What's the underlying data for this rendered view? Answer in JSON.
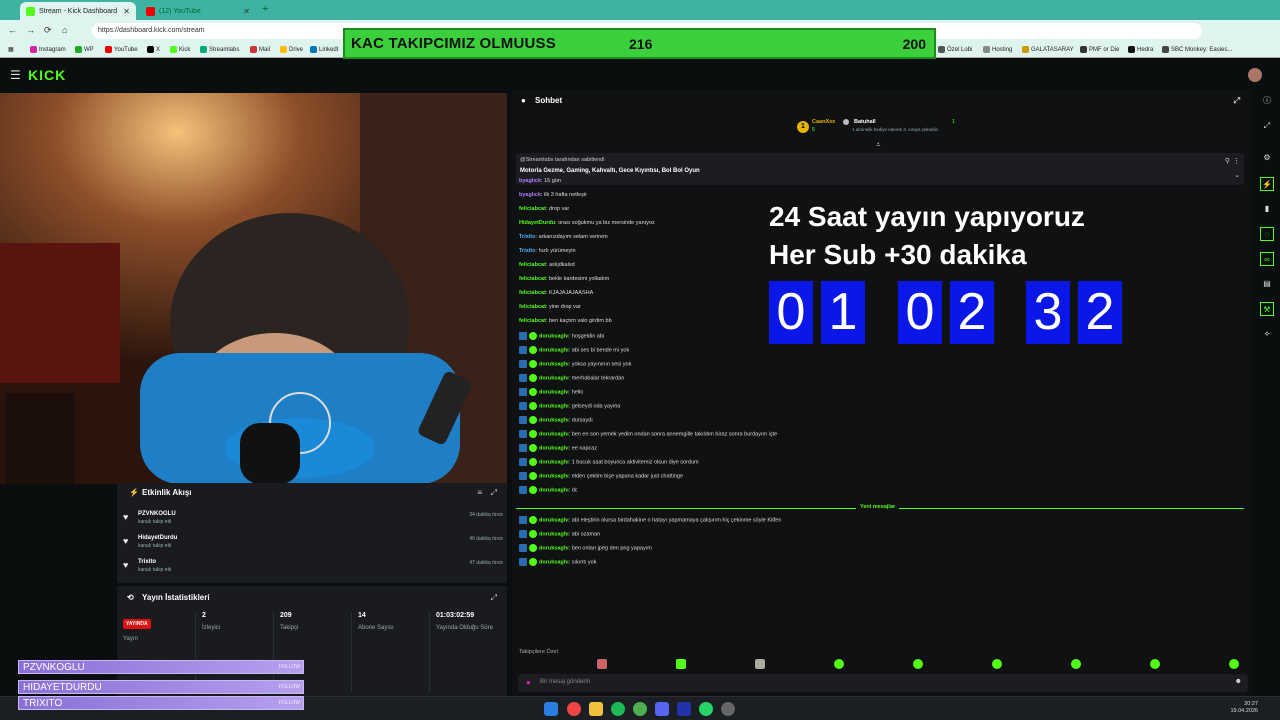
{
  "browser": {
    "tabs": [
      {
        "label": "Stream - Kick Dashboard"
      },
      {
        "label": "(12) YouTube"
      }
    ],
    "url": "https://dashboard.kick.com/stream",
    "bookmarks": [
      "Instagram",
      "WP",
      "YouTube",
      "X",
      "Kick",
      "Streamlabs",
      "Mail",
      "Drive",
      "LinkedI",
      "Özel Lobi",
      "Hosting",
      "GALATASARAY",
      "PMF or Die",
      "Hedra",
      "SBC Monkey: Easies..."
    ]
  },
  "goal": {
    "title": "KAC TAKIPCIMIZ OLMUUSS",
    "current": "216",
    "target": "200"
  },
  "header": {
    "logo": "KICK"
  },
  "activity": {
    "title": "Etkinlik Akışı",
    "items": [
      {
        "name": "PZVNKOGLU",
        "action": "kanalı takip etti",
        "time": "34 dakika önce"
      },
      {
        "name": "HidayetDurdu",
        "action": "kanalı takip etti",
        "time": "46 dakika önce"
      },
      {
        "name": "Trixito",
        "action": "kanalı takip etti",
        "time": "47 dakika önce"
      }
    ]
  },
  "stats": {
    "title": "Yayın İstatistikleri",
    "live_badge": "YAYINDA",
    "cols": [
      {
        "value": "",
        "label": "Yayın"
      },
      {
        "value": "2",
        "label": "İzleyici"
      },
      {
        "value": "209",
        "label": "Takipçi"
      },
      {
        "value": "14",
        "label": "Abone Sayısı"
      },
      {
        "value": "01:03:02:59",
        "label": "Yayında Olduğu Süre"
      }
    ]
  },
  "follow_alerts": [
    {
      "name": "PZVNKOGLU",
      "tag": "FOLLOW"
    },
    {
      "name": "HIDAYETDURDU",
      "tag": "FOLLOW"
    },
    {
      "name": "TRIXITO",
      "tag": "FOLLOW"
    }
  ],
  "chat": {
    "title": "Sohbet",
    "top_gifter": {
      "name": "CaanXxx",
      "count": "5"
    },
    "top_user": {
      "name": "Batuhall",
      "note": "1 abonelik hediye ederek 3. sıraya yükselin",
      "count": "1"
    },
    "pinned_by": "@Streamlabs tarafından sabitlendi",
    "pinned_text": "Motorla Gezme, Gaming, Kahvaltı, Gece Kıyıntısı, Bol Bol Oyun",
    "messages": [
      {
        "user": "byaglıck",
        "text": "15 gün",
        "color": "#b07cff"
      },
      {
        "user": "byaglıck",
        "text": "ilk 3 hafta netleşir",
        "color": "#b07cff"
      },
      {
        "user": "feliciabcat",
        "text": "drop var",
        "color": "#53fc18"
      },
      {
        "user": "HidayetDurdu",
        "text": "orası soğukmu ya biz mersinde yanıyoz",
        "color": "#53fc18"
      },
      {
        "user": "Trixito",
        "text": "arkanızdayım selam verirem",
        "color": "#4fb4ff"
      },
      {
        "user": "Trixito",
        "text": "hızlı yürümeyin",
        "color": "#4fb4ff"
      },
      {
        "user": "feliciabcat",
        "text": "aslıjdkalsd",
        "color": "#53fc18"
      },
      {
        "user": "feliciabcat",
        "text": "bekle kardesimi yolladım",
        "color": "#53fc18"
      },
      {
        "user": "feliciabcat",
        "text": "KJAJAJAJAASHA",
        "color": "#53fc18"
      },
      {
        "user": "feliciabcat",
        "text": "yine drop var",
        "color": "#53fc18"
      },
      {
        "user": "feliciabcat",
        "text": "ben kaçtım valo girdim bb",
        "color": "#53fc18"
      },
      {
        "user": "doruksaghı",
        "text": "hoşgeldin abi",
        "color": "#53fc18"
      },
      {
        "user": "doruksaghı",
        "text": "abi ses bi bende mi yok",
        "color": "#53fc18"
      },
      {
        "user": "doruksaghı",
        "text": "yoksa yayınının sesi yok",
        "color": "#53fc18"
      },
      {
        "user": "doruksaghı",
        "text": "merhabalar tekrardan",
        "color": "#53fc18"
      },
      {
        "user": "doruksaghı",
        "text": "hello",
        "color": "#53fc18"
      },
      {
        "user": "doruksaghı",
        "text": "gelseydi oda yayına",
        "color": "#53fc18"
      },
      {
        "user": "doruksaghı",
        "text": "dursaydı",
        "color": "#53fc18"
      },
      {
        "user": "doruksaghı",
        "text": "ben en son yemek yedim ondan sonra annemgille takıldım biraz sonra burdayım işte",
        "color": "#53fc18"
      },
      {
        "user": "doruksaghı",
        "text": "ee napcaz",
        "color": "#53fc18"
      },
      {
        "user": "doruksaghı",
        "text": "1 bucuk saat boyunca aktivitemiz olsun diye sordum",
        "color": "#53fc18"
      },
      {
        "user": "doruksaghı",
        "text": "elden çektim bişe yapana kadar just chattinge",
        "color": "#53fc18"
      },
      {
        "user": "doruksaghı",
        "text": "dc",
        "color": "#53fc18"
      }
    ],
    "new_label": "Yeni mesajlar",
    "new_messages": [
      {
        "user": "doruksaghı",
        "text": "abi eleştirin olursa birdahakine o hatayı yapmamaya çalışırım hiç çekinme söyle Kitfen"
      },
      {
        "user": "doruksaghı",
        "text": "abi ozaman"
      },
      {
        "user": "doruksaghı",
        "text": "ben onları jpeg den png yapayım"
      },
      {
        "user": "doruksaghı",
        "text": "sıkıntı yok"
      }
    ],
    "followers_only": "Takipçilere Özel",
    "input_placeholder": "Bir mesaj gönderin"
  },
  "timer": {
    "line1": "24 Saat yayın yapıyoruz",
    "line2": "Her Sub +30 dakika",
    "digits": [
      "0",
      "1",
      "0",
      "2",
      "3",
      "2"
    ]
  },
  "taskbar": {
    "time": "20:27",
    "date": "19.04.2026"
  },
  "colors": {
    "kick_green": "#53fc18",
    "timer_blue": "#0a17e6",
    "goal_green": "#3ccf3c",
    "alert_purple": "#8a6fd6"
  }
}
